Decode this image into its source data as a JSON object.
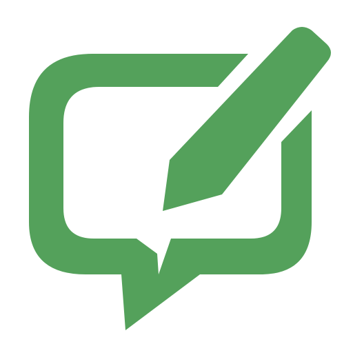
{
  "icon": {
    "name": "chat-edit-icon",
    "description_parts": [
      "speech-bubble-icon",
      "pencil-icon"
    ]
  },
  "colors": {
    "background": "#ffffff",
    "icon_fill": "#54a15b"
  }
}
